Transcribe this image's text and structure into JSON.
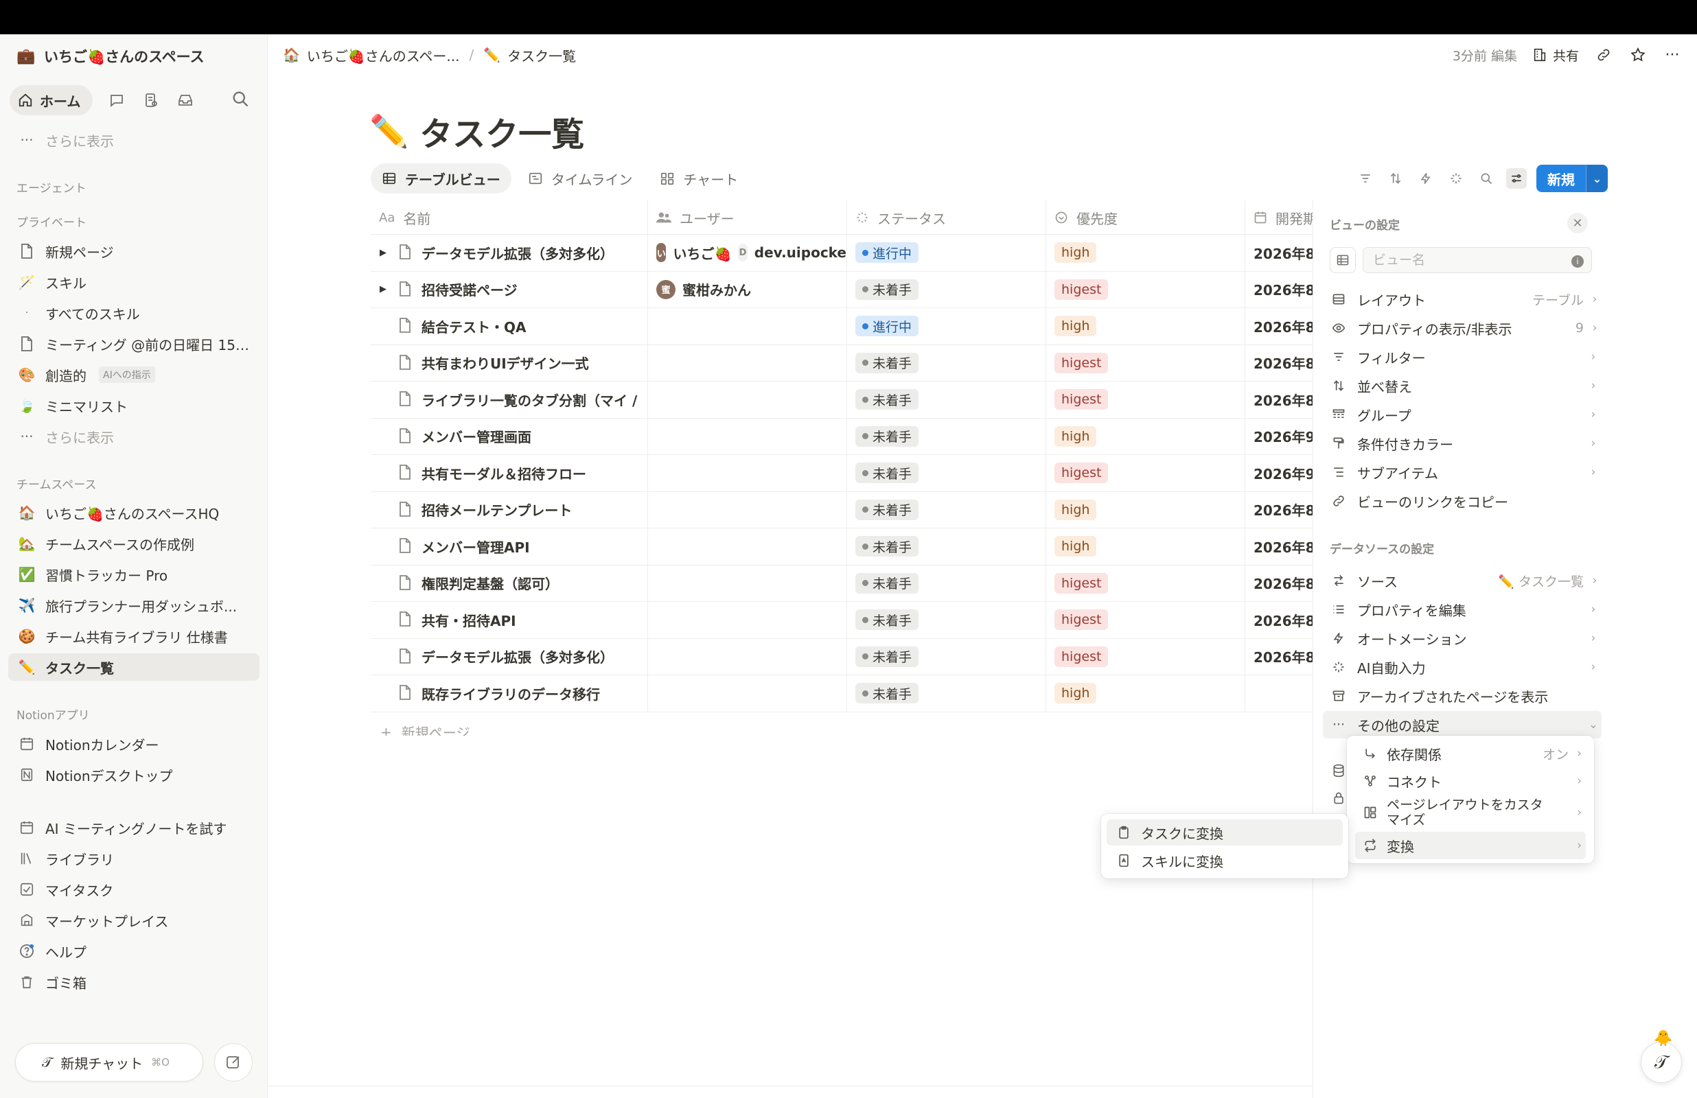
{
  "workspace": {
    "title": "いちご🍓さんのスペース",
    "icon": "briefcase-icon"
  },
  "nav": {
    "home": "ホーム"
  },
  "sidebar": {
    "show_more_top": "さらに表示",
    "agent_section": "エージェント",
    "private_section": "プライベート",
    "private_items": [
      {
        "label": "新規ページ",
        "icon": "page-icon"
      },
      {
        "label": "スキル",
        "icon": "wand-icon"
      },
      {
        "label": "すべてのスキル",
        "icon": "dot-icon"
      },
      {
        "label": "ミーティング @前の日曜日 15:...",
        "icon": "page-icon"
      },
      {
        "label": "創造的",
        "badge": "AIへの指示",
        "icon": "palette-icon"
      },
      {
        "label": "ミニマリスト",
        "icon": "leaf-icon"
      },
      {
        "label": "さらに表示",
        "icon": "ellipsis-icon"
      }
    ],
    "team_section": "チームスペース",
    "team_items": [
      {
        "label": "いちご🍓さんのスペースHQ",
        "icon": "house-icon"
      },
      {
        "label": "チームスペースの作成例",
        "icon": "home-emoji-icon"
      },
      {
        "label": "習慣トラッカー Pro",
        "icon": "check-badge-icon"
      },
      {
        "label": "旅行プランナー用ダッシュボ...",
        "icon": "airplane-icon"
      },
      {
        "label": "チーム共有ライブラリ 仕様書",
        "icon": "cookie-icon"
      },
      {
        "label": "タスク一覧",
        "icon": "pencil-icon"
      }
    ],
    "apps_section": "Notionアプリ",
    "app_items": [
      {
        "label": "Notionカレンダー",
        "icon": "calendar-icon"
      },
      {
        "label": "Notionデスクトップ",
        "icon": "notion-icon"
      }
    ],
    "bottom_items": [
      {
        "label": "AI ミーティングノートを試す",
        "icon": "calendar-icon"
      },
      {
        "label": "ライブラリ",
        "icon": "library-icon"
      },
      {
        "label": "マイタスク",
        "icon": "checkbox-icon"
      },
      {
        "label": "マーケットプレイス",
        "icon": "marketplace-icon"
      },
      {
        "label": "ヘルプ",
        "icon": "help-icon"
      },
      {
        "label": "ゴミ箱",
        "icon": "trash-icon"
      }
    ],
    "new_chat": "新規チャット",
    "new_chat_shortcut": "⌘O"
  },
  "header": {
    "breadcrumb_1": "いちご🍓さんのスペー...",
    "breadcrumb_2": "タスク一覧",
    "edited": "3分前 編集",
    "share": "共有"
  },
  "page": {
    "emoji": "✏️",
    "title": "タスク一覧"
  },
  "views": {
    "tabs": [
      {
        "label": "テーブルビュー",
        "active": true
      },
      {
        "label": "タイムライン",
        "active": false
      },
      {
        "label": "チャート",
        "active": false
      }
    ],
    "new_button": "新規"
  },
  "table": {
    "columns": [
      {
        "label": "名前",
        "icon": "Aa"
      },
      {
        "label": "ユーザー",
        "icon": "people-icon"
      },
      {
        "label": "ステータス",
        "icon": "status-icon"
      },
      {
        "label": "優先度",
        "icon": "priority-icon"
      },
      {
        "label": "開発期",
        "icon": "calendar-icon"
      }
    ],
    "rows": [
      {
        "name": "データモデル拡張（多対多化）",
        "expand": true,
        "users": [
          "いちご🍓",
          "dev.uipocke"
        ],
        "status": "進行中",
        "priority": "high",
        "date": "2026年8/"
      },
      {
        "name": "招待受諾ページ",
        "expand": true,
        "users": [
          "蜜柑みかん"
        ],
        "status": "未着手",
        "priority": "higest",
        "date": "2026年8/"
      },
      {
        "name": "結合テスト・QA",
        "expand": false,
        "users": [],
        "status": "進行中",
        "priority": "high",
        "date": "2026年8/"
      },
      {
        "name": "共有まわりUIデザイン一式",
        "expand": false,
        "users": [],
        "status": "未着手",
        "priority": "higest",
        "date": "2026年8/"
      },
      {
        "name": "ライブラリ一覧のタブ分割（マイ /",
        "expand": false,
        "users": [],
        "status": "未着手",
        "priority": "higest",
        "date": "2026年8/"
      },
      {
        "name": "メンバー管理画面",
        "expand": false,
        "users": [],
        "status": "未着手",
        "priority": "high",
        "date": "2026年9/"
      },
      {
        "name": "共有モーダル＆招待フロー",
        "expand": false,
        "users": [],
        "status": "未着手",
        "priority": "higest",
        "date": "2026年9/"
      },
      {
        "name": "招待メールテンプレート",
        "expand": false,
        "users": [],
        "status": "未着手",
        "priority": "high",
        "date": "2026年8/"
      },
      {
        "name": "メンバー管理API",
        "expand": false,
        "users": [],
        "status": "未着手",
        "priority": "high",
        "date": "2026年8/"
      },
      {
        "name": "権限判定基盤（認可）",
        "expand": false,
        "users": [],
        "status": "未着手",
        "priority": "higest",
        "date": "2026年8/"
      },
      {
        "name": "共有・招待API",
        "expand": false,
        "users": [],
        "status": "未着手",
        "priority": "higest",
        "date": "2026年8/"
      },
      {
        "name": "データモデル拡張（多対多化）",
        "expand": false,
        "users": [],
        "status": "未着手",
        "priority": "higest",
        "date": "2026年8/"
      },
      {
        "name": "既存ライブラリのデータ移行",
        "expand": false,
        "users": [],
        "status": "未着手",
        "priority": "high",
        "date": ""
      }
    ],
    "new_page": "新規ページ"
  },
  "settings": {
    "title": "ビューの設定",
    "view_name_placeholder": "ビュー名",
    "view_items": [
      {
        "label": "レイアウト",
        "value": "テーブル",
        "icon": "layout-icon"
      },
      {
        "label": "プロパティの表示/非表示",
        "value": "9",
        "icon": "eye-icon"
      },
      {
        "label": "フィルター",
        "value": "",
        "icon": "filter-icon"
      },
      {
        "label": "並べ替え",
        "value": "",
        "icon": "sort-icon"
      },
      {
        "label": "グループ",
        "value": "",
        "icon": "group-icon"
      },
      {
        "label": "条件付きカラー",
        "value": "",
        "icon": "paint-icon"
      },
      {
        "label": "サブアイテム",
        "value": "",
        "icon": "subitems-icon"
      },
      {
        "label": "ビューのリンクをコピー",
        "value": "",
        "icon": "link-icon"
      }
    ],
    "source_title": "データソースの設定",
    "source_items": [
      {
        "label": "ソース",
        "value": "✏️ タスク一覧",
        "icon": "source-icon"
      },
      {
        "label": "プロパティを編集",
        "value": "",
        "icon": "list-icon"
      },
      {
        "label": "オートメーション",
        "value": "",
        "icon": "bolt-icon"
      },
      {
        "label": "AI自動入力",
        "value": "",
        "icon": "sparkle-icon"
      },
      {
        "label": "アーカイブされたページを表示",
        "value": "",
        "icon": "archive-icon"
      },
      {
        "label": "その他の設定",
        "value": "",
        "icon": "ellipsis-icon"
      }
    ]
  },
  "more_menu": {
    "items": [
      {
        "label": "依存関係",
        "value": "オン",
        "icon": "dependency-icon"
      },
      {
        "label": "コネクト",
        "value": "",
        "icon": "connect-icon"
      },
      {
        "label": "ページレイアウトをカスタマイズ",
        "value": "",
        "icon": "page-layout-icon"
      },
      {
        "label": "変換",
        "value": "",
        "icon": "convert-icon"
      }
    ]
  },
  "convert_menu": {
    "items": [
      {
        "label": "タスクに変換",
        "icon": "clipboard-icon"
      },
      {
        "label": "スキルに変換",
        "icon": "skill-doc-icon"
      }
    ]
  },
  "colors": {
    "accent": "#2383e2",
    "status_progress_bg": "#dbeafa",
    "status_todo_bg": "#ececea",
    "priority_high_bg": "#fbecdd",
    "priority_higest_bg": "#fbe3e1"
  }
}
